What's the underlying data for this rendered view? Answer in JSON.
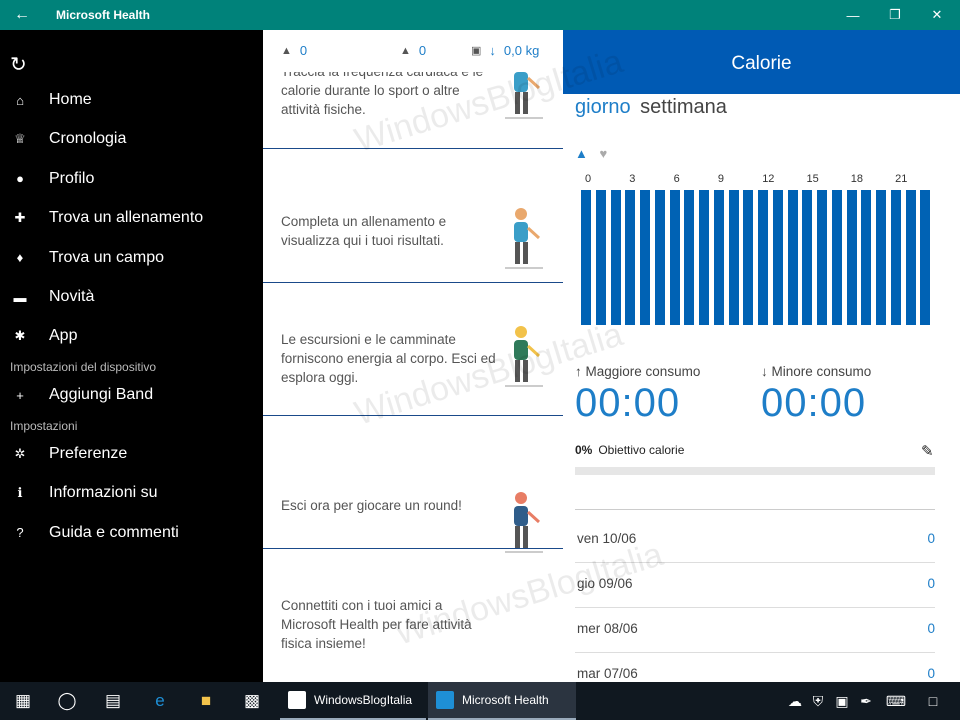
{
  "window": {
    "title": "Microsoft Health",
    "back_glyph": "←",
    "min_glyph": "—",
    "max_glyph": "❐",
    "close_glyph": "✕"
  },
  "sidebar": {
    "sync_glyph": "↻",
    "items": [
      {
        "label": "Home",
        "icon": "home-icon",
        "glyph": "⌂"
      },
      {
        "label": "Cronologia",
        "icon": "trophy-icon",
        "glyph": "♕"
      },
      {
        "label": "Profilo",
        "icon": "person-icon",
        "glyph": "●"
      },
      {
        "label": "Trova un allenamento",
        "icon": "workout-icon",
        "glyph": "✚"
      },
      {
        "label": "Trova un campo",
        "icon": "pin-icon",
        "glyph": "♦"
      },
      {
        "label": "Novità",
        "icon": "chat-icon",
        "glyph": "▬"
      },
      {
        "label": "App",
        "icon": "apps-icon",
        "glyph": "✱"
      }
    ],
    "device_section": "Impostazioni del dispositivo",
    "device_items": [
      {
        "label": "Aggiungi Band",
        "icon": "plus-icon",
        "glyph": "+"
      }
    ],
    "settings_section": "Impostazioni",
    "settings_items": [
      {
        "label": "Preferenze",
        "icon": "gear-icon",
        "glyph": "✲"
      },
      {
        "label": "Informazioni su",
        "icon": "info-icon",
        "glyph": "ℹ"
      },
      {
        "label": "Guida e commenti",
        "icon": "help-icon",
        "glyph": "?"
      }
    ]
  },
  "summary": {
    "steps": "0",
    "calories": "0",
    "weight": "0,0 kg",
    "steps_icon": "shoe-icon",
    "calories_icon": "flame-icon",
    "weight_icon": "scale-icon"
  },
  "cards": [
    {
      "text": "Traccia la frequenza cardiaca e le calorie durante lo sport o altre attività fisiche."
    },
    {
      "text": "Completa un allenamento e visualizza qui i tuoi risultati."
    },
    {
      "text": "Le escursioni e le camminate forniscono energia al corpo. Esci ed esplora oggi."
    },
    {
      "text": "Esci ora per giocare un round!"
    },
    {
      "text": "Connettiti con i tuoi amici a Microsoft Health per fare attività fisica insieme!"
    }
  ],
  "calories": {
    "header": "Calorie",
    "tabs": {
      "day": "giorno",
      "week": "settimana"
    },
    "toggle_icons": [
      "flame-icon",
      "heart-icon"
    ],
    "chart_ticks": [
      "0",
      "3",
      "6",
      "9",
      "12",
      "15",
      "18",
      "21"
    ],
    "bar_count": 24,
    "max_label": "Maggiore consumo",
    "max_value": "00:00",
    "min_label": "Minore consumo",
    "min_value": "00:00",
    "goal_percent": "0%",
    "goal_label": "Obiettivo calorie",
    "goal_fraction": 0,
    "days": [
      {
        "date": "ven 10/06",
        "value": "0"
      },
      {
        "date": "gio 09/06",
        "value": "0"
      },
      {
        "date": "mer 08/06",
        "value": "0"
      },
      {
        "date": "mar 07/06",
        "value": "0"
      }
    ]
  },
  "taskbar": {
    "apps": [
      {
        "label": "WindowsBlogItalia",
        "color": "#ffffff"
      },
      {
        "label": "Microsoft Health",
        "color": "#1e8fd6"
      }
    ]
  },
  "watermark": "WindowsBlogItalia",
  "colors": {
    "titlebar": "#00827a",
    "header": "#005ab4",
    "accent": "#1e7ec8",
    "bar": "#0062b4"
  }
}
